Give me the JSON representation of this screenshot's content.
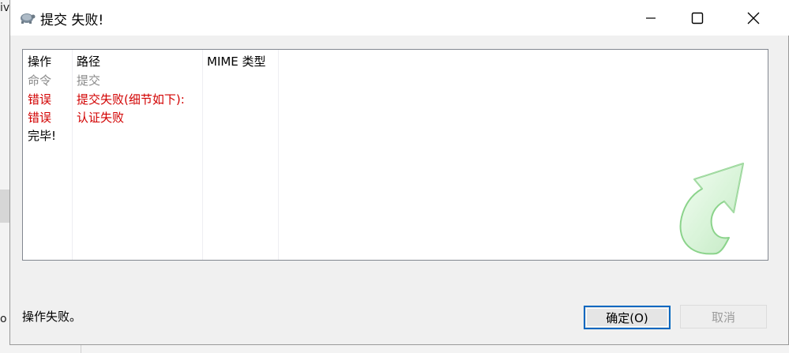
{
  "background": {
    "edge_text_top": "iv",
    "edge_text_bottom": "o"
  },
  "dialog": {
    "title": "提交 失败!",
    "icon": "tortoise-icon",
    "controls": {
      "minimize": "minimize-icon",
      "maximize": "maximize-icon",
      "close": "close-icon"
    }
  },
  "list": {
    "columns": [
      "操作",
      "路径",
      "MIME 类型"
    ],
    "rows": [
      {
        "action": "命令",
        "path": "提交",
        "color": "#8a8a8a"
      },
      {
        "action": "错误",
        "path": "提交失败(细节如下):",
        "color": "#d20000"
      },
      {
        "action": "错误",
        "path": "认证失败",
        "color": "#d20000"
      },
      {
        "action": "完毕!",
        "path": "",
        "color": "#000000"
      }
    ],
    "watermark_icon": "green-curved-arrow-icon"
  },
  "status": "操作失败。",
  "buttons": {
    "ok": "确定(O)",
    "cancel": "取消"
  },
  "colors": {
    "error": "#d20000",
    "command": "#8a8a8a",
    "focus_border": "#0067c0"
  }
}
